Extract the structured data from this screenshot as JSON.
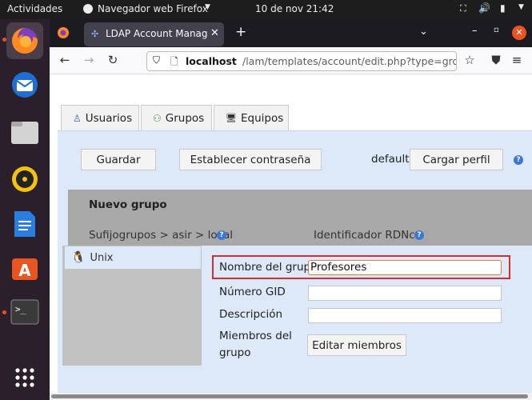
{
  "topbar": {
    "activities": "Actividades",
    "app_name": "Navegador web Firefox",
    "clock": "10 de nov  21:42"
  },
  "dock": {
    "items": [
      "firefox-icon",
      "thunderbird-icon",
      "files-icon",
      "rhythmbox-icon",
      "writer-icon",
      "software-icon",
      "terminal-icon",
      "app-grid-icon"
    ]
  },
  "browser": {
    "tab_title": "LDAP Account Manager (L",
    "url_host": "localhost",
    "url_path": "/lam/templates/account/edit.php?type=gro"
  },
  "page": {
    "tabs": [
      {
        "label": "Usuarios"
      },
      {
        "label": "Grupos"
      },
      {
        "label": "Equipos"
      }
    ],
    "save_label": "Guardar",
    "set_password_label": "Establecer contraseña",
    "profile_name": "default",
    "load_profile_label": "Cargar perfil",
    "header_title": "Nuevo grupo",
    "suffix_text": "Sufijogrupos > asir > local",
    "rdn_text": "Identificador RDNcn",
    "module_item": "Unix",
    "fields": {
      "group_name_label": "Nombre del grupo",
      "group_name_value": "Profesores",
      "gid_label": "Número GID",
      "gid_value": "",
      "description_label": "Descripción",
      "description_value": "",
      "members_label_line1": "Miembros del",
      "members_label_line2": "grupo",
      "edit_members_label": "Editar miembros"
    }
  },
  "colors": {
    "accent": "#e95420",
    "highlight_box": "#d32f2f",
    "panel_bg": "#dde8f8"
  }
}
